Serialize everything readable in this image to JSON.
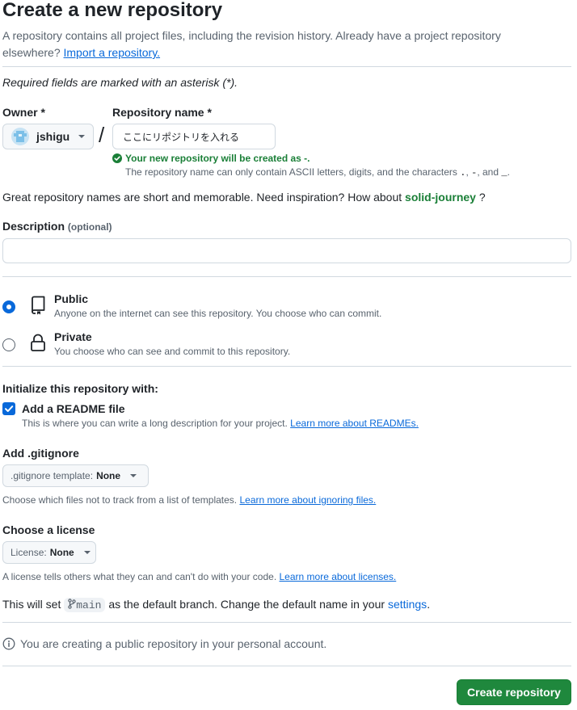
{
  "header": {
    "title": "Create a new repository",
    "intro_text": "A repository contains all project files, including the revision history. Already have a project repository elsewhere?",
    "import_link": "Import a repository."
  },
  "required_note": "Required fields are marked with an asterisk (*).",
  "owner": {
    "label": "Owner *",
    "value": "jshigu"
  },
  "repo_name": {
    "label": "Repository name *",
    "value": "ここにリポジトリを入れる",
    "success_text": "Your new repository will be created as -.",
    "rule_text_before": "The repository name can only contain ASCII letters, digits, and the characters",
    "rule_chars": [
      ".",
      "-",
      "_"
    ],
    "rule_sep_1": ",",
    "rule_sep_2": ", and",
    "rule_end": "."
  },
  "inspiration": {
    "text": "Great repository names are short and memorable. Need inspiration? How about",
    "suggestion": "solid-journey",
    "end": "?"
  },
  "description": {
    "label": "Description",
    "optional": "(optional)",
    "value": ""
  },
  "visibility": {
    "selected": "public",
    "public": {
      "title": "Public",
      "desc": "Anyone on the internet can see this repository. You choose who can commit."
    },
    "private": {
      "title": "Private",
      "desc": "You choose who can see and commit to this repository."
    }
  },
  "initialize": {
    "heading": "Initialize this repository with:",
    "readme": {
      "checked": true,
      "label": "Add a README file",
      "desc": "This is where you can write a long description for your project.",
      "link": "Learn more about READMEs."
    }
  },
  "gitignore": {
    "heading": "Add .gitignore",
    "select_label": ".gitignore template:",
    "select_value": "None",
    "desc": "Choose which files not to track from a list of templates.",
    "link": "Learn more about ignoring files."
  },
  "license": {
    "heading": "Choose a license",
    "select_label": "License:",
    "select_value": "None",
    "desc": "A license tells others what they can and can't do with your code.",
    "link": "Learn more about licenses."
  },
  "branch": {
    "before": "This will set",
    "name": "main",
    "after": "as the default branch. Change the default name in your",
    "link": "settings",
    "end": "."
  },
  "notice": "You are creating a public repository in your personal account.",
  "submit_label": "Create repository",
  "colors": {
    "primary_button": "#1f883d",
    "link": "#0969da",
    "success": "#1a7f37"
  }
}
